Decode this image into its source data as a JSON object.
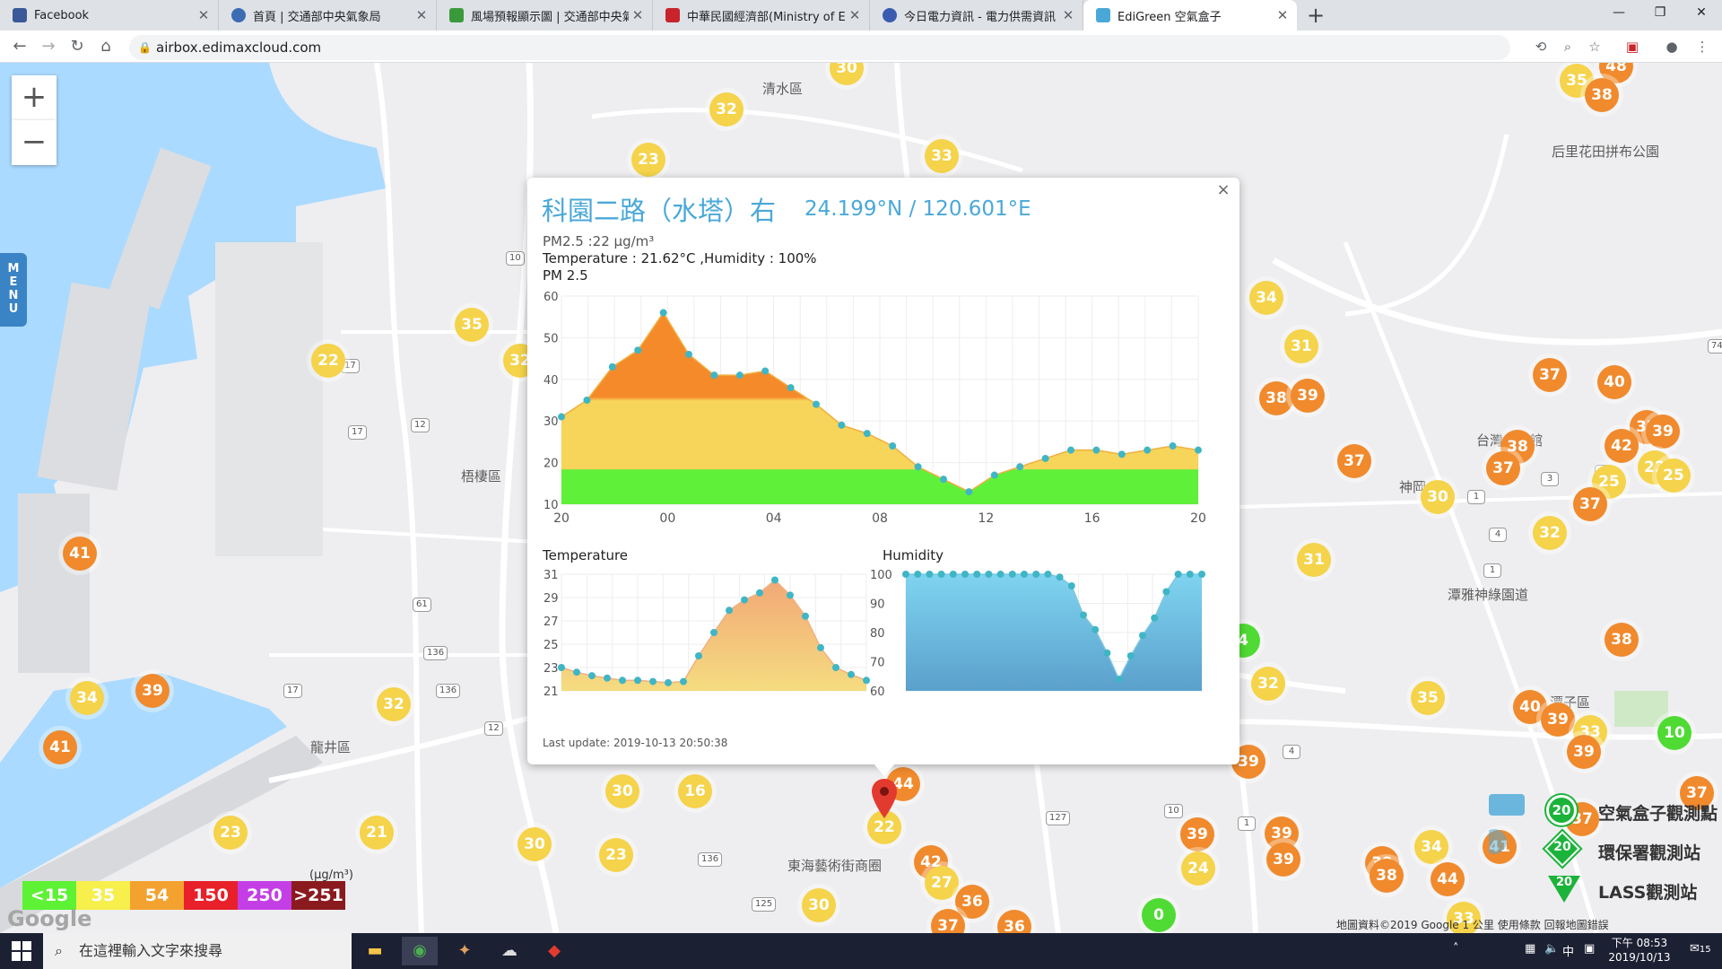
{
  "browser": {
    "tabs": [
      {
        "title": "Facebook",
        "color": "#3b5998"
      },
      {
        "title": "首頁 | 交通部中央氣象局",
        "color": "#3c6cb4"
      },
      {
        "title": "風場預報顯示圖 | 交通部中央氣象",
        "color": "#3a9a3a"
      },
      {
        "title": "中華民國經濟部(Ministry of Econ",
        "color": "#c8242b"
      },
      {
        "title": "今日電力資訊 - 電力供需資訊 - 台",
        "color": "#3a5bb0"
      },
      {
        "title": "EdiGreen 空氣盒子",
        "color": "#4aa8d8"
      }
    ],
    "url": "airbox.edimaxcloud.com"
  },
  "map": {
    "place_labels": [
      "清水區",
      "梧棲區",
      "龍井區",
      "神岡",
      "潭子區",
      "后里花田拼布公園",
      "台灣...物館",
      "潭雅神綠園道",
      "東海藝術街商圈"
    ],
    "road_labels": [
      "10",
      "17",
      "12",
      "17",
      "61",
      "136",
      "136",
      "17",
      "12",
      "136",
      "125",
      "127",
      "10",
      "1",
      "4",
      "1",
      "4",
      "3",
      "1",
      "74",
      "1"
    ],
    "markers": [
      {
        "value": "30",
        "color": "yellow",
        "cx": 944,
        "cy": 76
      },
      {
        "value": "32",
        "color": "yellow",
        "cx": 810,
        "cy": 122
      },
      {
        "value": "23",
        "color": "yellow",
        "cx": 723,
        "cy": 178
      },
      {
        "value": "33",
        "color": "yellow",
        "cx": 1050,
        "cy": 174
      },
      {
        "value": "35",
        "color": "yellow",
        "cx": 1758,
        "cy": 90
      },
      {
        "value": "48",
        "color": "orange",
        "cx": 1802,
        "cy": 74
      },
      {
        "value": "38",
        "color": "orange",
        "cx": 1786,
        "cy": 106
      },
      {
        "value": "35",
        "color": "yellow",
        "cx": 526,
        "cy": 362
      },
      {
        "value": "22",
        "color": "yellow",
        "cx": 366,
        "cy": 402
      },
      {
        "value": "32",
        "color": "yellow",
        "cx": 580,
        "cy": 402
      },
      {
        "value": "34",
        "color": "yellow",
        "cx": 1412,
        "cy": 332
      },
      {
        "value": "31",
        "color": "yellow",
        "cx": 1451,
        "cy": 386
      },
      {
        "value": "38",
        "color": "orange",
        "cx": 1423,
        "cy": 444
      },
      {
        "value": "39",
        "color": "orange",
        "cx": 1458,
        "cy": 441
      },
      {
        "value": "37",
        "color": "orange",
        "cx": 1728,
        "cy": 418
      },
      {
        "value": "40",
        "color": "orange",
        "cx": 1800,
        "cy": 426
      },
      {
        "value": "37",
        "color": "orange",
        "cx": 1836,
        "cy": 476
      },
      {
        "value": "39",
        "color": "orange",
        "cx": 1854,
        "cy": 481
      },
      {
        "value": "38",
        "color": "orange",
        "cx": 1692,
        "cy": 498
      },
      {
        "value": "42",
        "color": "orange",
        "cx": 1808,
        "cy": 497
      },
      {
        "value": "37",
        "color": "orange",
        "cx": 1676,
        "cy": 522
      },
      {
        "value": "37",
        "color": "orange",
        "cx": 1510,
        "cy": 514
      },
      {
        "value": "25",
        "color": "yellow",
        "cx": 1794,
        "cy": 537
      },
      {
        "value": "22",
        "color": "yellow",
        "cx": 1845,
        "cy": 521
      },
      {
        "value": "25",
        "color": "yellow",
        "cx": 1866,
        "cy": 530
      },
      {
        "value": "30",
        "color": "yellow",
        "cx": 1603,
        "cy": 554
      },
      {
        "value": "37",
        "color": "orange",
        "cx": 1773,
        "cy": 562
      },
      {
        "value": "32",
        "color": "yellow",
        "cx": 1728,
        "cy": 594
      },
      {
        "value": "31",
        "color": "yellow",
        "cx": 1465,
        "cy": 624
      },
      {
        "value": "41",
        "color": "orange",
        "cx": 89,
        "cy": 617
      },
      {
        "value": "4",
        "color": "green",
        "cx": 1386,
        "cy": 714
      },
      {
        "value": "38",
        "color": "orange",
        "cx": 1808,
        "cy": 713
      },
      {
        "value": "39",
        "color": "orange",
        "cx": 170,
        "cy": 770
      },
      {
        "value": "34",
        "color": "yellow",
        "cx": 97,
        "cy": 778
      },
      {
        "value": "32",
        "color": "yellow",
        "cx": 439,
        "cy": 785
      },
      {
        "value": "32",
        "color": "yellow",
        "cx": 1414,
        "cy": 762
      },
      {
        "value": "35",
        "color": "yellow",
        "cx": 1592,
        "cy": 778
      },
      {
        "value": "40",
        "color": "orange",
        "cx": 1706,
        "cy": 788
      },
      {
        "value": "39",
        "color": "orange",
        "cx": 1737,
        "cy": 802
      },
      {
        "value": "33",
        "color": "yellow",
        "cx": 1773,
        "cy": 816
      },
      {
        "value": "39",
        "color": "orange",
        "cx": 1766,
        "cy": 838
      },
      {
        "value": "10",
        "color": "green",
        "cx": 1867,
        "cy": 817
      },
      {
        "value": "41",
        "color": "orange",
        "cx": 67,
        "cy": 833
      },
      {
        "value": "39",
        "color": "orange",
        "cx": 1392,
        "cy": 849
      },
      {
        "value": "30",
        "color": "yellow",
        "cx": 694,
        "cy": 882
      },
      {
        "value": "16",
        "color": "yellow",
        "cx": 775,
        "cy": 882
      },
      {
        "value": "44",
        "color": "orange",
        "cx": 1007,
        "cy": 874
      },
      {
        "value": "37",
        "color": "orange",
        "cx": 1892,
        "cy": 884
      },
      {
        "value": "37",
        "color": "orange",
        "cx": 1764,
        "cy": 913
      },
      {
        "value": "23",
        "color": "yellow",
        "cx": 257,
        "cy": 928
      },
      {
        "value": "21",
        "color": "yellow",
        "cx": 420,
        "cy": 928
      },
      {
        "value": "30",
        "color": "yellow",
        "cx": 596,
        "cy": 941
      },
      {
        "value": "23",
        "color": "yellow",
        "cx": 687,
        "cy": 953
      },
      {
        "value": "39",
        "color": "orange",
        "cx": 1335,
        "cy": 930
      },
      {
        "value": "39",
        "color": "orange",
        "cx": 1429,
        "cy": 929
      },
      {
        "value": "39",
        "color": "orange",
        "cx": 1431,
        "cy": 958
      },
      {
        "value": "34",
        "color": "yellow",
        "cx": 1596,
        "cy": 944
      },
      {
        "value": "41",
        "color": "orange",
        "cx": 1672,
        "cy": 944
      },
      {
        "value": "42",
        "color": "orange",
        "cx": 1038,
        "cy": 961
      },
      {
        "value": "24",
        "color": "yellow",
        "cx": 1336,
        "cy": 968
      },
      {
        "value": "39",
        "color": "orange",
        "cx": 1541,
        "cy": 962
      },
      {
        "value": "38",
        "color": "orange",
        "cx": 1546,
        "cy": 976
      },
      {
        "value": "44",
        "color": "orange",
        "cx": 1614,
        "cy": 980
      },
      {
        "value": "27",
        "color": "yellow",
        "cx": 1050,
        "cy": 984
      },
      {
        "value": "36",
        "color": "orange",
        "cx": 1084,
        "cy": 1005
      },
      {
        "value": "30",
        "color": "yellow",
        "cx": 913,
        "cy": 1009
      },
      {
        "value": "0",
        "color": "green",
        "cx": 1292,
        "cy": 1020
      },
      {
        "value": "33",
        "color": "yellow",
        "cx": 1632,
        "cy": 1024
      },
      {
        "value": "36",
        "color": "orange",
        "cx": 1131,
        "cy": 1033
      },
      {
        "value": "37",
        "color": "orange",
        "cx": 1057,
        "cy": 1032
      },
      {
        "value": "22",
        "color": "yellow",
        "cx": 986,
        "cy": 922
      }
    ],
    "legend": {
      "items": [
        {
          "label": "<15",
          "color": "#5df234"
        },
        {
          "label": "35",
          "color": "#f7ef4c"
        },
        {
          "label": "54",
          "color": "#f4a22f"
        },
        {
          "label": "150",
          "color": "#e8202a"
        },
        {
          "label": "250",
          "color": "#c43ee6"
        },
        {
          "label": ">251",
          "color": "#8a1a1e"
        }
      ],
      "unit": "(μg/m³)"
    },
    "site_legend": [
      {
        "label": "空氣盒子觀測點",
        "badge": "20"
      },
      {
        "label": "環保署觀測站",
        "badge": "20"
      },
      {
        "label": "LASS觀測站",
        "badge": "20"
      }
    ],
    "footer": "地圖資料©2019 Google    1 公里            使用條款    回報地圖錯誤",
    "zoom_in": "+",
    "zoom_out": "−",
    "menu": "M E N U",
    "google": "Google"
  },
  "popup": {
    "title": "科園二路（水塔）右",
    "coords": "24.199°N / 120.601°E",
    "pm": "PM2.5 :22 μg/m³",
    "temp_hum": "Temperature : 21.62°C ,Humidity : 100%",
    "pm_chart_title": "PM 2.5",
    "temp_chart_title": "Temperature",
    "hum_chart_title": "Humidity",
    "last_update": "Last update: 2019-10-13 20:50:38",
    "close": "×"
  },
  "chart_data": [
    {
      "type": "area",
      "title": "PM 2.5",
      "x_ticks": [
        "20",
        "00",
        "04",
        "08",
        "12",
        "16",
        "20"
      ],
      "y_ticks": [
        "10",
        "20",
        "30",
        "40",
        "50",
        "60"
      ],
      "ylim": [
        10,
        60
      ],
      "values": [
        31,
        35,
        43,
        47,
        56,
        46,
        41,
        41,
        42,
        38,
        34,
        29,
        27,
        24,
        19,
        16,
        13,
        17,
        19,
        21,
        23,
        23,
        22,
        23,
        24,
        23
      ]
    },
    {
      "type": "area",
      "title": "Temperature",
      "y_ticks": [
        "21",
        "23",
        "25",
        "27",
        "29",
        "31"
      ],
      "ylim": [
        21,
        31
      ],
      "values": [
        23.0,
        22.6,
        22.3,
        22.1,
        21.9,
        21.9,
        21.8,
        21.7,
        21.8,
        24.0,
        26.0,
        27.9,
        28.8,
        29.4,
        30.5,
        29.2,
        27.4,
        24.7,
        23.0,
        22.4,
        21.9
      ]
    },
    {
      "type": "area",
      "title": "Humidity",
      "y_ticks": [
        "60",
        "70",
        "80",
        "90",
        "100"
      ],
      "ylim": [
        60,
        100
      ],
      "values": [
        100,
        100,
        100,
        100,
        100,
        100,
        100,
        100,
        100,
        100,
        100,
        100,
        100,
        99,
        96,
        86,
        81,
        73,
        64,
        72,
        79,
        85,
        94,
        100,
        100,
        100
      ]
    }
  ],
  "taskbar": {
    "search_placeholder": "在這裡輸入文字來搜尋",
    "time": "下午 08:53",
    "date": "2019/10/13",
    "ime": "中",
    "notif_count": "15"
  }
}
